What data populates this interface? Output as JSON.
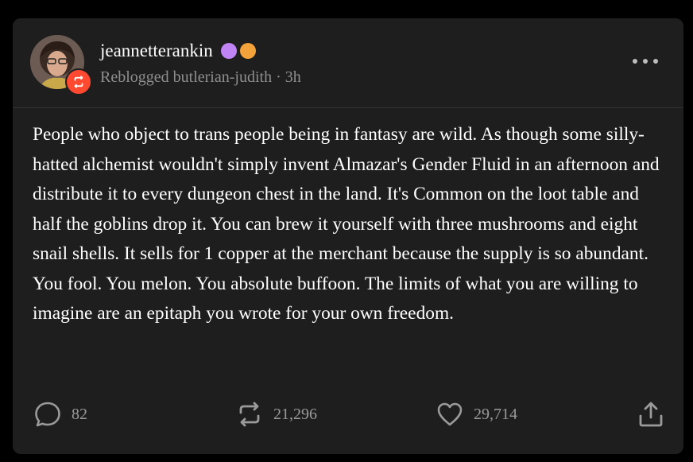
{
  "post": {
    "username": "jeannetterankin",
    "badges": [
      {
        "icon": "purple-badge-icon",
        "color": "#c084f5"
      },
      {
        "icon": "orange-paw-badge-icon",
        "color": "#f4a23a"
      }
    ],
    "meta": "Reblogged butlerian-judith · 3h",
    "body": "People who object to trans people being in fantasy are wild. As though some silly-hatted alchemist wouldn't simply invent Almazar's Gender Fluid in an afternoon and distribute it to every dungeon chest in the land. It's Common on the loot table and half the goblins drop it. You can brew it yourself with three mushrooms and eight snail shells. It sells for 1 copper at the merchant because the supply is so abundant. You fool. You melon. You absolute buffoon. The limits of what you are willing to imagine are an epitaph you wrote for your own freedom."
  },
  "actions": {
    "replies": "82",
    "reblogs": "21,296",
    "likes": "29,714"
  },
  "colors": {
    "background": "#000000",
    "card": "#1e1e1e",
    "reblog_accent": "#ff4930",
    "muted_text": "#8e8e8e"
  }
}
